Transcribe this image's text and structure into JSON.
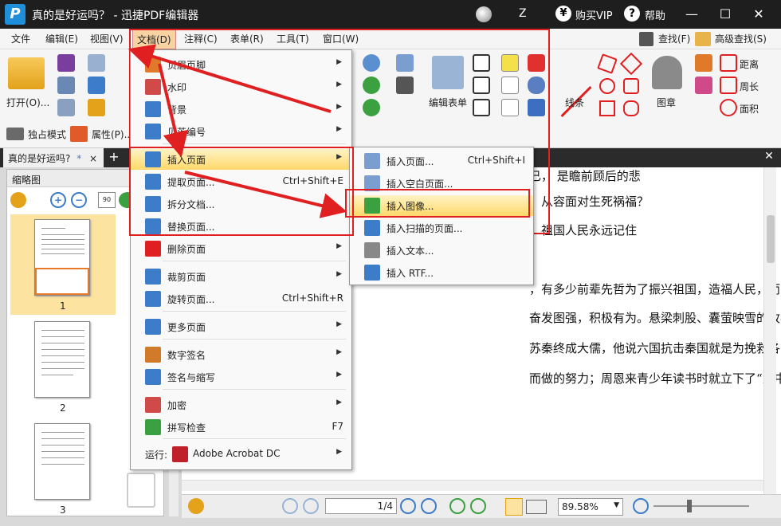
{
  "titlebar": {
    "title": "真的是好运吗？ - 迅捷PDF编辑器",
    "user": "Z",
    "vip": "购买VIP",
    "help": "帮助",
    "logo": "P"
  },
  "menubar": [
    "文件",
    "编辑(E)",
    "视图(V)",
    "文档(D)",
    "注释(C)",
    "表单(R)",
    "工具(T)",
    "窗口(W)"
  ],
  "menubar_right": {
    "find": "查找(F)",
    "adv_find": "高级查找(S)"
  },
  "ribbon": {
    "open": "打开(O)...",
    "exclusive": "独占模式",
    "properties": "属性(P)...",
    "edit_form": "编辑表单",
    "lines": "线条",
    "stamp": "图章",
    "distance": "距离",
    "perimeter": "周长",
    "area": "面积"
  },
  "tab": {
    "name": "真的是好运吗?",
    "mark": "*",
    "close": "×",
    "add": "+"
  },
  "thumbs": {
    "title": "缩略图",
    "pages": [
      "1",
      "2",
      "3"
    ]
  },
  "document": {
    "lines": [
      "已，  是瞻前顾后的悲",
      "，从容面对生死祸福？",
      "，祖国人民永远记住",
      "，有多少前辈先哲为了振兴祖国，造福人民，而",
      "奋发图强，积极有为。悬梁刺股、囊萤映雪的故事",
      "苏秦终成大儒，他说六国抗击秦国就是为挽救各国",
      "而做的努力；周恩来青少年读书时就立下了“为中"
    ]
  },
  "status": {
    "page": "1",
    "total": "/4",
    "zoom": "89.58%"
  },
  "menu1": [
    {
      "label": "页眉页脚",
      "sc": "",
      "sub": true
    },
    {
      "label": "水印",
      "sc": "",
      "sub": true
    },
    {
      "label": "背景",
      "sc": "",
      "sub": true
    },
    {
      "label": "贝茨编号",
      "sc": "",
      "sub": true
    },
    {
      "label": "插入页面",
      "sc": "",
      "sub": true
    },
    {
      "label": "提取页面...",
      "sc": "Ctrl+Shift+E",
      "sub": false
    },
    {
      "label": "拆分文档...",
      "sc": "",
      "sub": false
    },
    {
      "label": "替换页面...",
      "sc": "",
      "sub": false
    },
    {
      "label": "删除页面",
      "sc": "",
      "sub": true
    },
    {
      "label": "裁剪页面",
      "sc": "",
      "sub": true
    },
    {
      "label": "旋转页面...",
      "sc": "Ctrl+Shift+R",
      "sub": false
    },
    {
      "label": "更多页面",
      "sc": "",
      "sub": true
    },
    {
      "label": "数字签名",
      "sc": "",
      "sub": true
    },
    {
      "label": "签名与缩写",
      "sc": "",
      "sub": true
    },
    {
      "label": "加密",
      "sc": "",
      "sub": true
    },
    {
      "label": "拼写检查",
      "sc": "F7",
      "sub": false
    },
    {
      "label": "Adobe Acrobat DC",
      "sc": "",
      "sub": true,
      "prefix": "运行:"
    }
  ],
  "menu2": [
    {
      "label": "插入页面...",
      "sc": "Ctrl+Shift+I"
    },
    {
      "label": "插入空白页面...",
      "sc": ""
    },
    {
      "label": "插入图像...",
      "sc": ""
    },
    {
      "label": "插入扫描的页面...",
      "sc": ""
    },
    {
      "label": "插入文本...",
      "sc": ""
    },
    {
      "label": "插入 RTF...",
      "sc": ""
    }
  ],
  "colors": {
    "highlight": "#ffd86a",
    "annotation_red": "#e02020",
    "titlebar": "#1e1e1e"
  }
}
